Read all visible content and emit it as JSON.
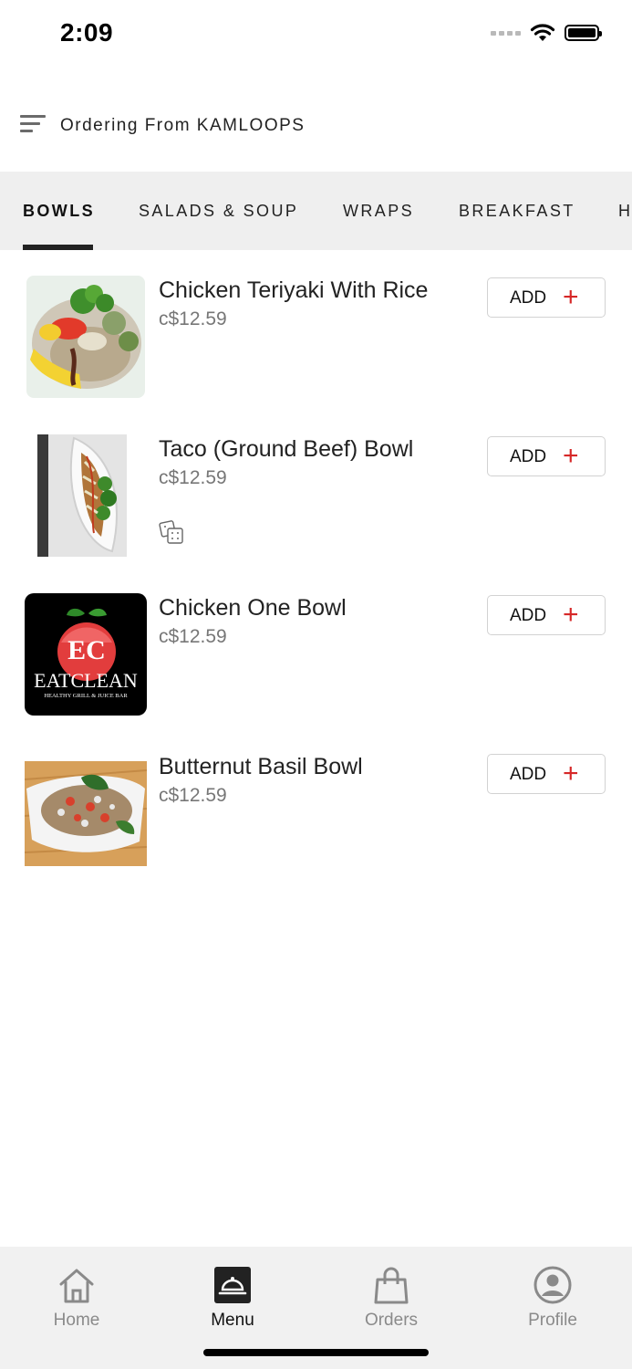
{
  "status_bar": {
    "time": "2:09"
  },
  "header": {
    "title": "Ordering From KAMLOOPS"
  },
  "tabs": [
    {
      "label": "BOWLS",
      "active": true
    },
    {
      "label": "SALADS & SOUP",
      "active": false
    },
    {
      "label": "WRAPS",
      "active": false
    },
    {
      "label": "BREAKFAST",
      "active": false
    },
    {
      "label": "H",
      "active": false
    }
  ],
  "items": [
    {
      "name": "Chicken Teriyaki With Rice",
      "price": "c$12.59",
      "add_label": "ADD",
      "add_icon": "+"
    },
    {
      "name": "Taco (Ground Beef) Bowl",
      "price": "c$12.59",
      "add_label": "ADD",
      "add_icon": "+",
      "tag_icon": "cracker-icon"
    },
    {
      "name": "Chicken One Bowl",
      "price": "c$12.59",
      "add_label": "ADD",
      "add_icon": "+"
    },
    {
      "name": "Butternut Basil Bowl",
      "price": "c$12.59",
      "add_label": "ADD",
      "add_icon": "+"
    }
  ],
  "logo": {
    "letters": "EC",
    "brand": "EATCLEAN",
    "tagline": "HEALTHY GRILL & JUICE BAR"
  },
  "bottom_nav": [
    {
      "label": "Home",
      "icon": "home-icon",
      "active": false
    },
    {
      "label": "Menu",
      "icon": "cloche-icon",
      "active": true
    },
    {
      "label": "Orders",
      "icon": "shopping-bag-icon",
      "active": false
    },
    {
      "label": "Profile",
      "icon": "profile-icon",
      "active": false
    }
  ],
  "colors": {
    "accent": "#d62828",
    "tab_bar": "#efefef",
    "nav_bar": "#f1f1f1"
  }
}
